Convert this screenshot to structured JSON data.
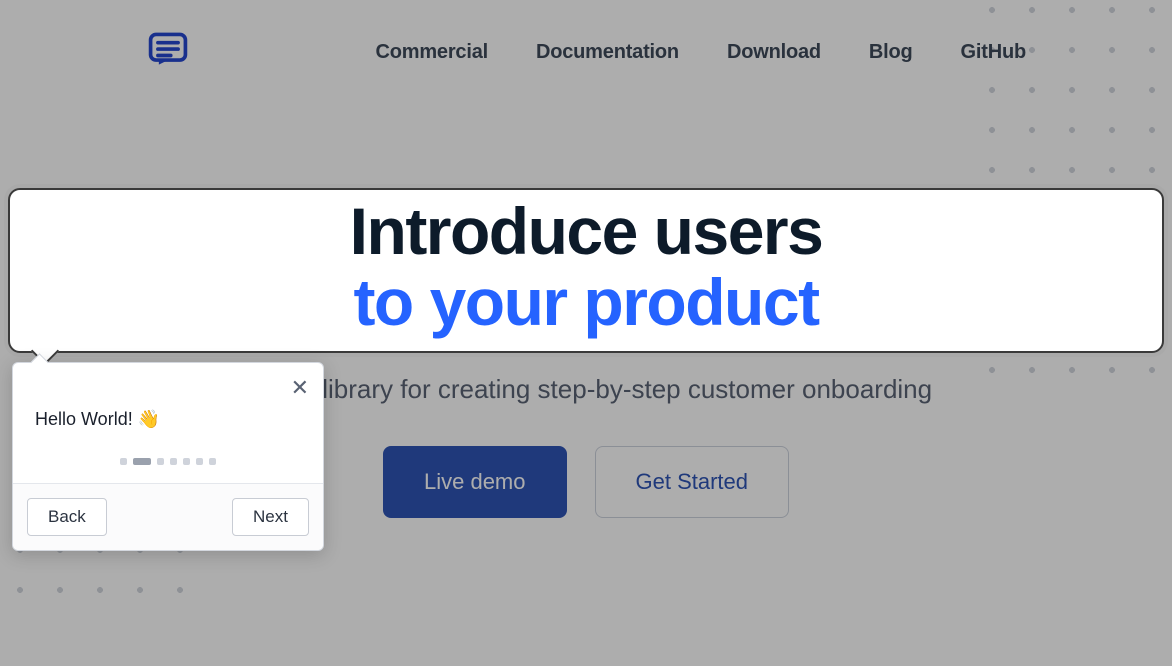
{
  "nav": {
    "items": [
      "Commercial",
      "Documentation",
      "Download",
      "Blog",
      "GitHub"
    ]
  },
  "hero": {
    "line1": "Introduce users",
    "line2": "to your product",
    "subtitle_visible": "weight library for creating step-by-step customer onboarding"
  },
  "cta": {
    "primary": "Live demo",
    "secondary": "Get Started"
  },
  "tooltip": {
    "text": "Hello World! 👋",
    "back": "Back",
    "next": "Next",
    "total_steps": 7,
    "active_step_index": 1
  }
}
